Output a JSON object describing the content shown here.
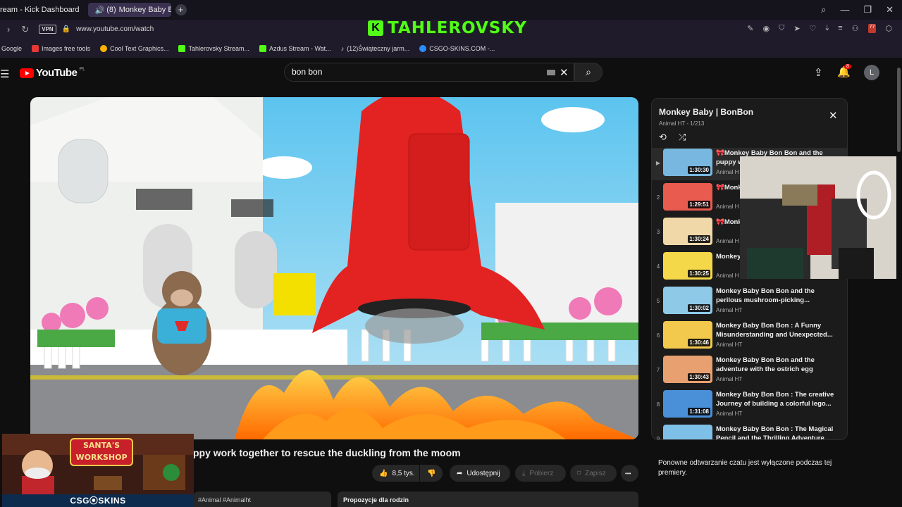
{
  "browser": {
    "tabs": [
      {
        "label": "ream - Kick Dashboard"
      },
      {
        "label": "(8)",
        "active_label": "Monkey Baby B"
      }
    ],
    "url": "www.youtube.com/watch",
    "vpn": "VPN",
    "bookmarks": [
      {
        "label": "Google",
        "color": "#4285f4"
      },
      {
        "label": "Images free tools",
        "color": "#e53935"
      },
      {
        "label": "Cool Text Graphics...",
        "color": "#ffb300"
      },
      {
        "label": "Tahlerovsky Stream...",
        "color": "#53fc18"
      },
      {
        "label": "Azdus Stream - Wat...",
        "color": "#53fc18"
      },
      {
        "label": "(12)Świąteczny jarm...",
        "color": "#ffffff"
      },
      {
        "label": "CSGO-SKINS.COM -...",
        "color": "#2b8cff"
      }
    ],
    "extension_badge": "77"
  },
  "stream_overlay": {
    "banner_text": "TAHLEROVSKY",
    "k_logo": "K",
    "csg_bar": "CSG⦿SKINS",
    "santa_sign": "SANTA'S WORKSHOP"
  },
  "youtube": {
    "logo_word": "YouTube",
    "region": "PL",
    "search_value": "bon bon",
    "notification_count": "8",
    "avatar_letter": "L"
  },
  "video": {
    "title": "ppy work together to rescue the duckling from the moom",
    "likes": "8,5 tys.",
    "share_label": "Udostępnij",
    "download_label": "Pobierz",
    "save_label": "Zapisz",
    "more_label": "•••",
    "hashtags": "#Animal #Animalht",
    "family_chip": "Propozycje dla rodzin"
  },
  "playlist": {
    "title": "Monkey Baby | BonBon",
    "subtitle": "Animal HT - 1/213",
    "items": [
      {
        "index": "▶",
        "duration": "1:30:30",
        "title": "🎀Monkey Baby Bon Bon and the puppy w",
        "channel": "Animal H",
        "thumb_color": "#78b8e0"
      },
      {
        "index": "2",
        "duration": "1:29:51",
        "title": "🎀Monk Puppy a",
        "channel": "Animal H",
        "thumb_color": "#e95a4f"
      },
      {
        "index": "3",
        "duration": "1:30:24",
        "title": "🎀Monk go eat a",
        "channel": "Animal H",
        "thumb_color": "#f0d8a8"
      },
      {
        "index": "4",
        "duration": "1:30:25",
        "title": "Monkey duckling",
        "channel": "Animal H",
        "thumb_color": "#f5d84a"
      },
      {
        "index": "5",
        "duration": "1:30:02",
        "title": "Monkey Baby Bon Bon and the perilous mushroom-picking...",
        "channel": "Animal HT",
        "thumb_color": "#8ec9e8"
      },
      {
        "index": "6",
        "duration": "1:30:46",
        "title": "Monkey Baby Bon Bon : A Funny Misunderstanding and Unexpected...",
        "channel": "Animal HT",
        "thumb_color": "#f2c94c"
      },
      {
        "index": "7",
        "duration": "1:30:43",
        "title": "Monkey Baby Bon Bon and the adventure with the ostrich egg",
        "channel": "Animal HT",
        "thumb_color": "#e8a070"
      },
      {
        "index": "8",
        "duration": "1:31:08",
        "title": "Monkey Baby Bon Bon : The creative Journey of building a colorful lego...",
        "channel": "Animal HT",
        "thumb_color": "#4a90d9"
      },
      {
        "index": "9",
        "duration": "",
        "title": "Monkey Baby Bon Bon : The Magical Pencil and the Thrilling Adventure",
        "channel": "",
        "thumb_color": "#7ec0e8"
      }
    ]
  },
  "chat_note": "Ponowne odtwarzanie czatu jest wyłączone podczas tej premiery."
}
